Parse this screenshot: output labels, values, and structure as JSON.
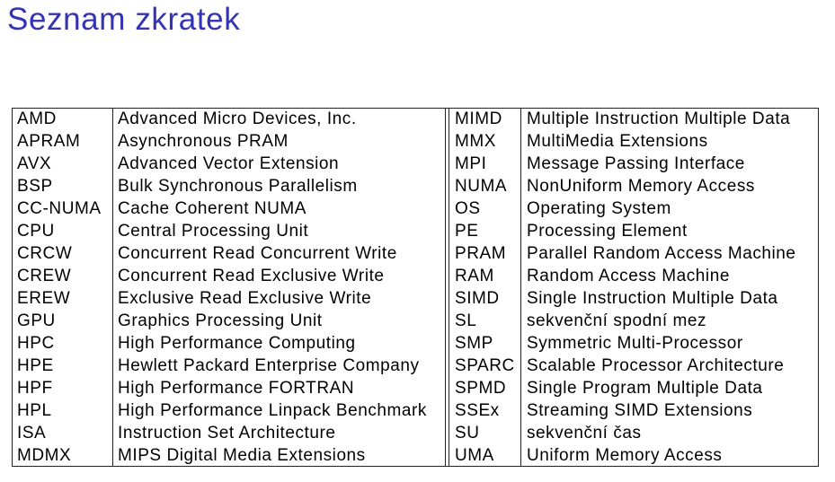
{
  "title": "Seznam zkratek",
  "colors": {
    "title": "#3333b3"
  },
  "left": [
    {
      "abbr": "AMD",
      "desc": "Advanced Micro Devices, Inc."
    },
    {
      "abbr": "APRAM",
      "desc": "Asynchronous PRAM"
    },
    {
      "abbr": "AVX",
      "desc": "Advanced Vector Extension"
    },
    {
      "abbr": "BSP",
      "desc": "Bulk Synchronous Parallelism"
    },
    {
      "abbr": "CC-NUMA",
      "desc": "Cache Coherent NUMA"
    },
    {
      "abbr": "CPU",
      "desc": "Central Processing Unit"
    },
    {
      "abbr": "CRCW",
      "desc": "Concurrent Read Concurrent Write"
    },
    {
      "abbr": "CREW",
      "desc": "Concurrent Read Exclusive Write"
    },
    {
      "abbr": "EREW",
      "desc": "Exclusive Read Exclusive Write"
    },
    {
      "abbr": "GPU",
      "desc": "Graphics Processing Unit"
    },
    {
      "abbr": "HPC",
      "desc": "High Performance Computing"
    },
    {
      "abbr": "HPE",
      "desc": "Hewlett Packard Enterprise Company"
    },
    {
      "abbr": "HPF",
      "desc": "High Performance FORTRAN"
    },
    {
      "abbr": "HPL",
      "desc": "High Performance Linpack Benchmark"
    },
    {
      "abbr": "ISA",
      "desc": "Instruction Set Architecture"
    },
    {
      "abbr": "MDMX",
      "desc": "MIPS Digital Media Extensions"
    }
  ],
  "right": [
    {
      "abbr": "MIMD",
      "desc": "Multiple Instruction Multiple Data"
    },
    {
      "abbr": "MMX",
      "desc": "MultiMedia Extensions"
    },
    {
      "abbr": "MPI",
      "desc": "Message Passing Interface"
    },
    {
      "abbr": "NUMA",
      "desc": "NonUniform Memory Access"
    },
    {
      "abbr": "OS",
      "desc": "Operating System"
    },
    {
      "abbr": "PE",
      "desc": "Processing Element"
    },
    {
      "abbr": "PRAM",
      "desc": "Parallel Random Access Machine"
    },
    {
      "abbr": "RAM",
      "desc": "Random Access Machine"
    },
    {
      "abbr": "SIMD",
      "desc": "Single Instruction Multiple Data"
    },
    {
      "abbr": "SL",
      "desc": "sekvenční spodní mez"
    },
    {
      "abbr": "SMP",
      "desc": "Symmetric Multi-Processor"
    },
    {
      "abbr": "SPARC",
      "desc": "Scalable Processor Architecture"
    },
    {
      "abbr": "SPMD",
      "desc": "Single Program Multiple Data"
    },
    {
      "abbr": "SSEx",
      "desc": "Streaming SIMD Extensions"
    },
    {
      "abbr": "SU",
      "desc": "sekvenční čas"
    },
    {
      "abbr": "UMA",
      "desc": "Uniform Memory Access"
    }
  ]
}
